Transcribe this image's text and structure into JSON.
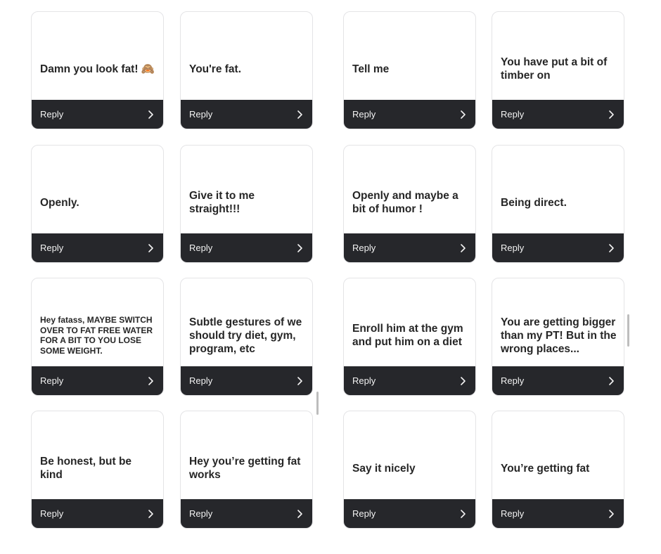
{
  "reply_label": "Reply",
  "colors": {
    "bar": "#26272b",
    "text": "#262626",
    "border": "#e4e4e6"
  },
  "icons": {
    "reply_arrow": "chevron-right-icon"
  },
  "cards": [
    {
      "text": "Damn you look fat! 🙈"
    },
    {
      "text": "You're fat."
    },
    {
      "text": "Tell me"
    },
    {
      "text": "You have put a bit of timber on"
    },
    {
      "text": "Openly."
    },
    {
      "text": "Give it to me straight!!!"
    },
    {
      "text": "Openly and maybe a bit of humor !"
    },
    {
      "text": "Being direct."
    },
    {
      "text": "Hey fatass, MAYBE SWITCH OVER TO FAT FREE WATER FOR A BIT TO YOU LOSE SOME WEIGHT."
    },
    {
      "text": "Subtle gestures of we should try diet, gym, program, etc"
    },
    {
      "text": "Enroll him at the gym and put him on a diet"
    },
    {
      "text": "You are getting bigger than my PT! But in the wrong places..."
    },
    {
      "text": "Be honest, but be kind"
    },
    {
      "text": "Hey you’re getting fat works"
    },
    {
      "text": "Say it nicely"
    },
    {
      "text": "You’re getting fat"
    }
  ]
}
